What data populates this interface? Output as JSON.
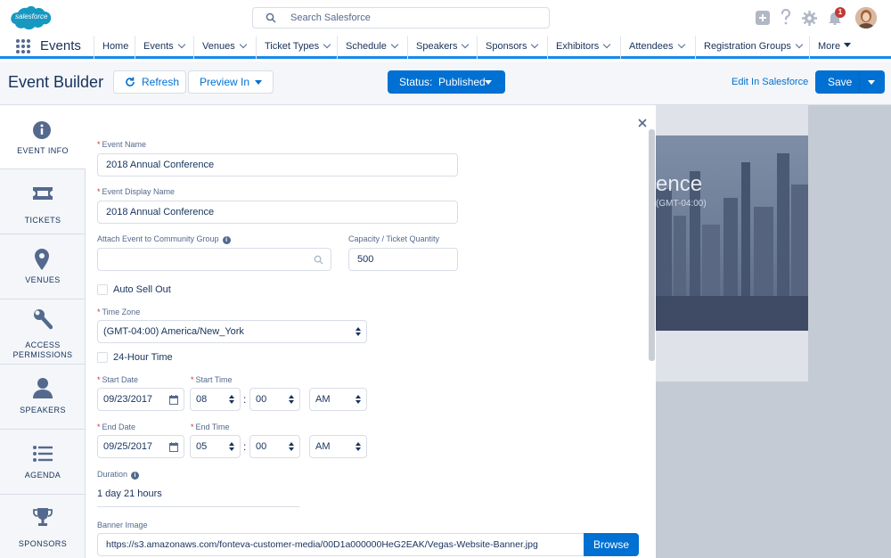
{
  "brand": {
    "logo_text": "salesforce",
    "accent": "#0070d2",
    "brand_blue": "#1589ee"
  },
  "search": {
    "placeholder": "Search Salesforce"
  },
  "header_icons": [
    "add-icon",
    "help-icon",
    "setup-gear-icon",
    "notifications-bell-icon"
  ],
  "notifications": {
    "count": "1"
  },
  "nav": {
    "app_name": "Events",
    "items": [
      "Home",
      "Events",
      "Venues",
      "Ticket Types",
      "Schedule",
      "Speakers",
      "Sponsors",
      "Exhibitors",
      "Attendees",
      "Registration Groups",
      "More"
    ]
  },
  "builder": {
    "title": "Event Builder",
    "refresh_label": "Refresh",
    "preview_label": "Preview In",
    "status_label": "Status:  Published",
    "edit_link": "Edit In Salesforce",
    "save_label": "Save"
  },
  "sidebar": {
    "items": [
      {
        "label": "EVENT INFO",
        "icon": "info-icon"
      },
      {
        "label": "TICKETS",
        "icon": "ticket-icon"
      },
      {
        "label": "VENUES",
        "icon": "location-pin-icon"
      },
      {
        "label": "ACCESS",
        "label2": "PERMISSIONS",
        "icon": "wrench-icon"
      },
      {
        "label": "SPEAKERS",
        "icon": "person-icon"
      },
      {
        "label": "AGENDA",
        "icon": "list-icon"
      },
      {
        "label": "SPONSORS",
        "icon": "trophy-icon"
      }
    ]
  },
  "form": {
    "event_name": {
      "label": "Event Name",
      "value": "2018 Annual Conference"
    },
    "display_name": {
      "label": "Event Display Name",
      "value": "2018 Annual Conference"
    },
    "community_group": {
      "label": "Attach Event to Community Group",
      "value": ""
    },
    "capacity": {
      "label": "Capacity / Ticket Quantity",
      "value": "500"
    },
    "auto_sell_out": "Auto Sell Out",
    "time_zone": {
      "label": "Time Zone",
      "value": "(GMT-04:00) America/New_York"
    },
    "hour24": "24-Hour Time",
    "start_date": {
      "label": "Start Date",
      "value": "09/23/2017"
    },
    "start_time": {
      "label": "Start Time",
      "hour": "08",
      "minute": "00",
      "ampm": "AM"
    },
    "end_date": {
      "label": "End Date",
      "value": "09/25/2017"
    },
    "end_time": {
      "label": "End Time",
      "hour": "05",
      "minute": "00",
      "ampm": "AM"
    },
    "duration": {
      "label": "Duration",
      "value": "1 day 21 hours"
    },
    "banner": {
      "label": "Banner Image",
      "value": "https://s3.amazonaws.com/fonteva-customer-media/00D1a000000HeG2EAK/Vegas-Website-Banner.jpg",
      "browse_label": "Browse"
    }
  },
  "preview": {
    "title": "ence",
    "subtitle": "(GMT-04:00)"
  }
}
